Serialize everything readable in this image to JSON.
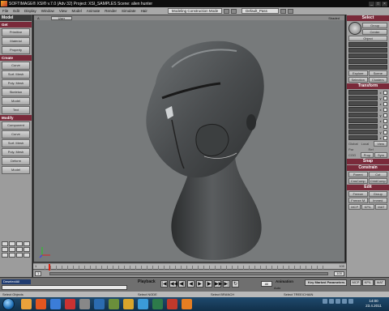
{
  "titlebar": {
    "title": "SOFTIMAGE® XSI® v.7.0 (Adv 32) Project: XSI_SAMPLES   Scene: alien hunter",
    "controls": [
      "_",
      "□",
      "×"
    ]
  },
  "menubar": {
    "items": [
      "File",
      "Edit",
      "Display",
      "Window",
      "View",
      "Model",
      "Animate",
      "Render",
      "Simulate",
      "Hair"
    ],
    "mode": "Modeling Construction Mode",
    "pass": "Default_Pass"
  },
  "left_panel": {
    "title": "Model",
    "sections": [
      {
        "label": "Get",
        "buttons": [
          "Primitive",
          "Material",
          "Property"
        ]
      },
      {
        "label": "Create",
        "buttons": [
          "Curve",
          "Surf. Mesh",
          "Poly. Mesh",
          "Skeleton",
          "Model",
          "Text"
        ]
      },
      {
        "label": "Modify",
        "buttons": [
          "Component",
          "Curve",
          "Surf. Mesh",
          "Poly. Mesh",
          "Deform",
          "Model"
        ]
      }
    ]
  },
  "viewport": {
    "label": "A",
    "camera": "User",
    "shading": "Shaded"
  },
  "right_panel": {
    "select_title": "Select",
    "group_label": "Group",
    "center_label": "Center",
    "object_label": "Object",
    "explore_label": "Explore",
    "scene_label": "Scene",
    "selection_label": "Selection",
    "clusters_label": "Clusters",
    "transform_title": "Transform",
    "transform_axes": [
      "x",
      "y",
      "z",
      "x",
      "y",
      "z",
      "x",
      "y",
      "z"
    ],
    "global_label": "Global",
    "local_label": "Local",
    "view_label": "View",
    "par_label": "Par",
    "ref_label": "Ref",
    "cog_label": "COG",
    "prop_label": "Prop",
    "sym_label": "Sym",
    "snap_title": "Snap",
    "constrain_title": "Constrain",
    "parent_label": "Parent",
    "cut_label": "Cut",
    "cnscomp_label": "CnsComp",
    "childcomp_label": "ChldComp",
    "edit_title": "Edit",
    "freeze_label": "Freeze",
    "group2_label": "Group",
    "freeze_m_label": "Freeze M",
    "immed_label": "Immed",
    "mcp_label": "MCP",
    "kp_label": "KP/L",
    "mat_label": "MAT"
  },
  "timeline": {
    "start_num": "1",
    "end_num": "100",
    "range_start": "1",
    "range_end": "100",
    "current_frame": "1",
    "frame_field": "All"
  },
  "bottom": {
    "command": "DeselectAll",
    "playback_label": "Playback",
    "transport": [
      "|◀",
      "◀◀",
      "◀|",
      "◀",
      "▶",
      "|▶",
      "▶▶",
      "▶|",
      "↻"
    ],
    "animation_label": "Animation",
    "auto_label": "Auto",
    "key_marked_label": "Key Marked Parameters",
    "mcp_tabs": [
      "MCP",
      "KP/L",
      "MAT"
    ]
  },
  "status": {
    "left": "Select Objects",
    "mid1": "Select NODE",
    "mid2": "Select BRANCH",
    "mid3": "Select TREE/CHAIN"
  },
  "taskbar": {
    "time": "14:00",
    "date": "23.4.2011"
  }
}
